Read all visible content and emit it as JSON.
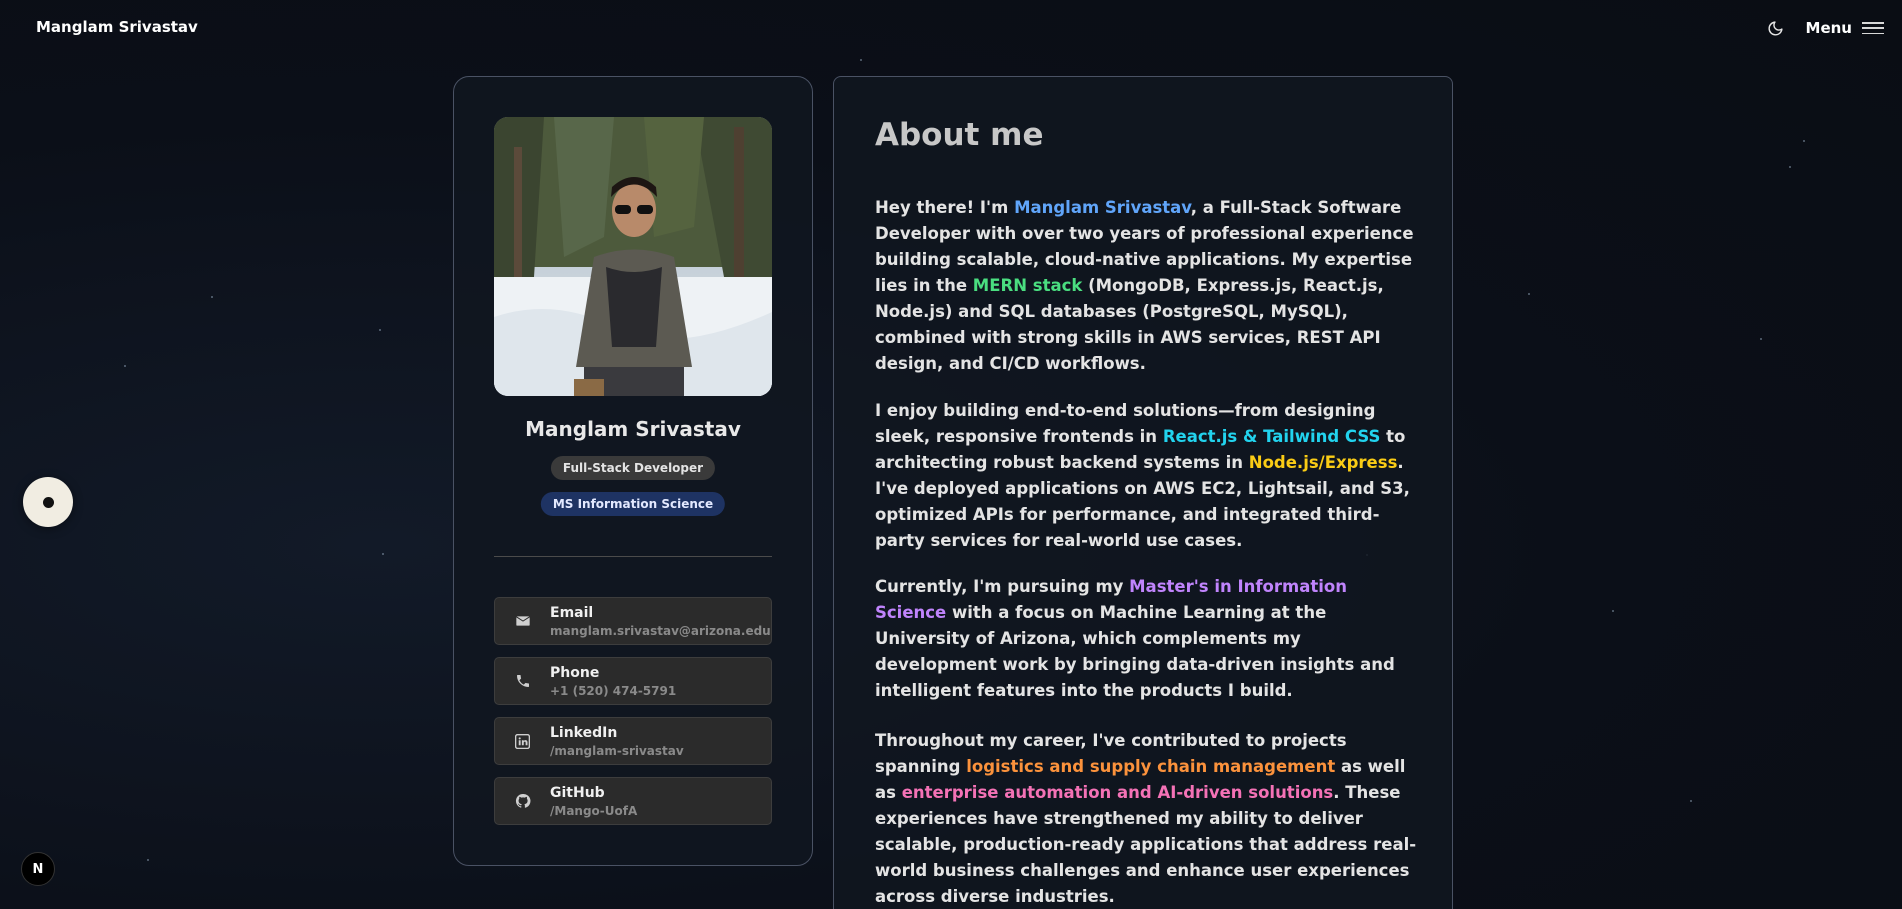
{
  "brand": "Manglam Srivastav",
  "nav": {
    "menu_label": "Menu",
    "theme_icon": "moon-icon",
    "menu_icon": "hamburger-icon"
  },
  "badge_letter": "N",
  "profile": {
    "name": "Manglam Srivastav",
    "role": "Full-Stack Developer",
    "degree": "MS Information Science",
    "contacts": [
      {
        "label": "Email",
        "value": "manglam.srivastav@arizona.edu",
        "icon": "mail-icon"
      },
      {
        "label": "Phone",
        "value": "+1 (520) 474-5791",
        "icon": "phone-icon"
      },
      {
        "label": "LinkedIn",
        "value": "/manglam-srivastav",
        "icon": "linkedin-icon"
      },
      {
        "label": "GitHub",
        "value": "/Mango-UofA",
        "icon": "github-icon"
      }
    ]
  },
  "about": {
    "title": "About me",
    "p1": {
      "a": "Hey there! I'm ",
      "name": "Manglam Srivastav",
      "b": ", a Full-Stack Software Developer with over two years of professional experience building scalable, cloud-native applications. My expertise lies in the ",
      "mern": "MERN stack",
      "c": " (MongoDB, Express.js, React.js, Node.js) and SQL databases (PostgreSQL, MySQL), combined with strong skills in AWS services, REST API design, and CI/CD workflows."
    },
    "p2": {
      "a": "I enjoy building end-to-end solutions—from designing sleek, responsive frontends in ",
      "react": "React.js & Tailwind CSS",
      "b": " to architecting robust backend systems in ",
      "node": "Node.js/Express",
      "c": ". I've deployed applications on AWS EC2, Lightsail, and S3, optimized APIs for performance, and integrated third-party services for real-world use cases."
    },
    "p3": {
      "a": "Currently, I'm pursuing my ",
      "masters": "Master's in Information Science",
      "b": " with a focus on Machine Learning at the University of Arizona, which complements my development work by bringing data-driven insights and intelligent features into the products I build."
    },
    "p4": {
      "a": "Throughout my career, I've contributed to projects spanning ",
      "logistics": "logistics and supply chain management",
      "b": " as well as ",
      "enterprise": "enterprise automation and AI-driven solutions",
      "c": ". These experiences have strengthened my ability to deliver scalable, production-ready applications that address real-world business challenges and enhance user experiences across diverse industries."
    }
  },
  "colors": {
    "accent_blue": "#60a5fa",
    "accent_green": "#4ade80",
    "accent_cyan": "#22d3ee",
    "accent_yellow": "#facc15",
    "accent_purple": "#c084fc",
    "accent_orange": "#fb923c",
    "accent_pink": "#f472b6"
  }
}
